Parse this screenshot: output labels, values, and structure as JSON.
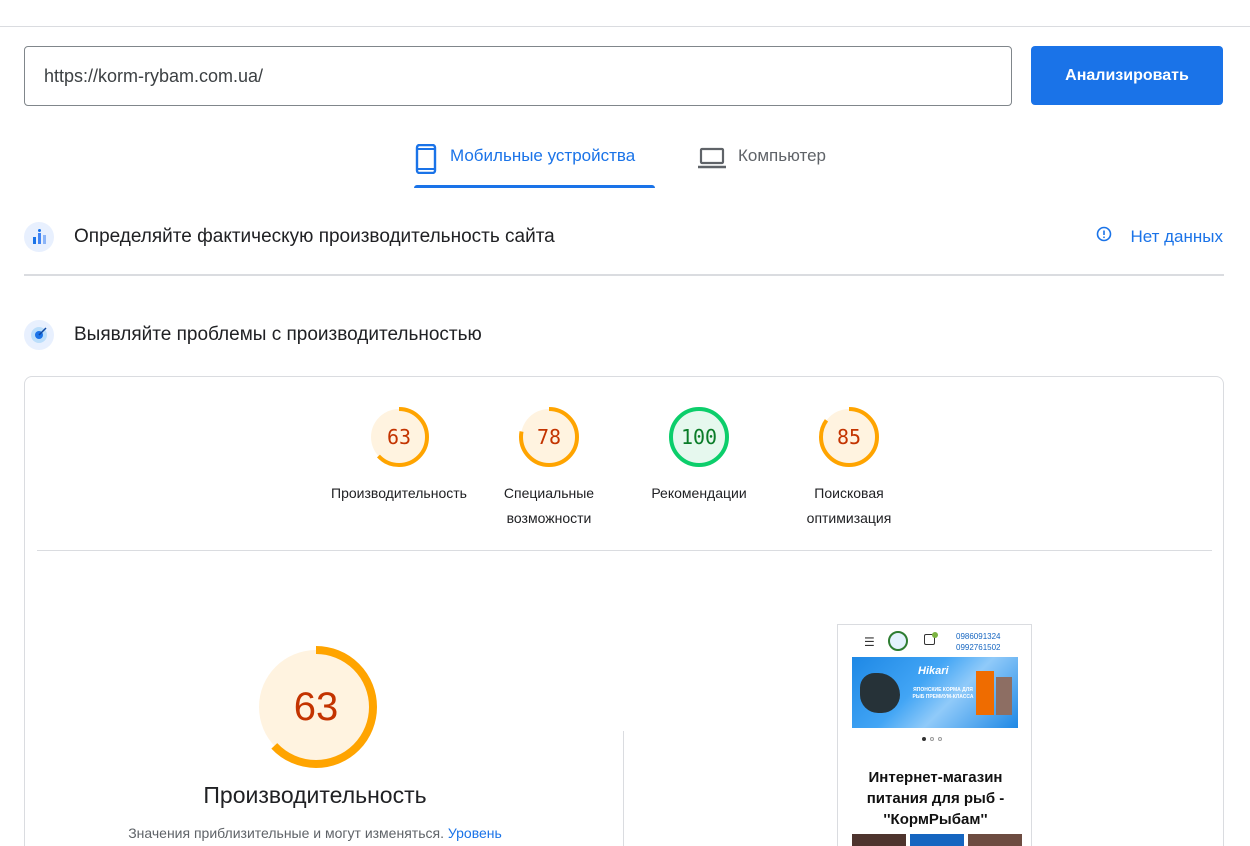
{
  "search": {
    "url_value": "https://korm-rybam.com.ua/",
    "analyze_label": "Анализировать"
  },
  "tabs": [
    {
      "label": "Мобильные устройства",
      "icon": "smartphone-icon",
      "active": true
    },
    {
      "label": "Компьютер",
      "icon": "laptop-icon",
      "active": false
    }
  ],
  "field_data": {
    "title": "Определяйте фактическую производительность сайта",
    "status": "Нет данных",
    "status_icon": "info-icon"
  },
  "lab_data": {
    "title": "Выявляйте проблемы с производительностью"
  },
  "scores": [
    {
      "value": "63",
      "score": 63,
      "label": "Производительность",
      "color": "#ffa400",
      "fill": "#fff3e0"
    },
    {
      "value": "78",
      "score": 78,
      "label": "Специальные возможности",
      "color": "#ffa400",
      "fill": "#fff3e0"
    },
    {
      "value": "100",
      "score": 100,
      "label": "Рекомендации",
      "color": "#0cce6b",
      "fill": "#e6f8ee"
    },
    {
      "value": "85",
      "score": 85,
      "label": "Поисковая оптимизация",
      "color": "#ffa400",
      "fill": "#fff3e0"
    }
  ],
  "performance": {
    "value": "63",
    "score": 63,
    "title": "Производительность",
    "note": "Значения приблизительные и могут изменяться.",
    "note_link": "Уровень"
  },
  "preview": {
    "phone1": "0986091324",
    "phone2": "0992761502",
    "banner_brand": "Hikari",
    "banner_text": "ЯПОНСКИЕ КОРМА ДЛЯ РЫБ ПРЕМИУМ-КЛАССА",
    "heading": "Интернет-магазин питания для рыб - ''КормРыбам''"
  },
  "colors": {
    "accent": "#1a73e8",
    "average": "#ffa400",
    "good": "#0cce6b"
  }
}
